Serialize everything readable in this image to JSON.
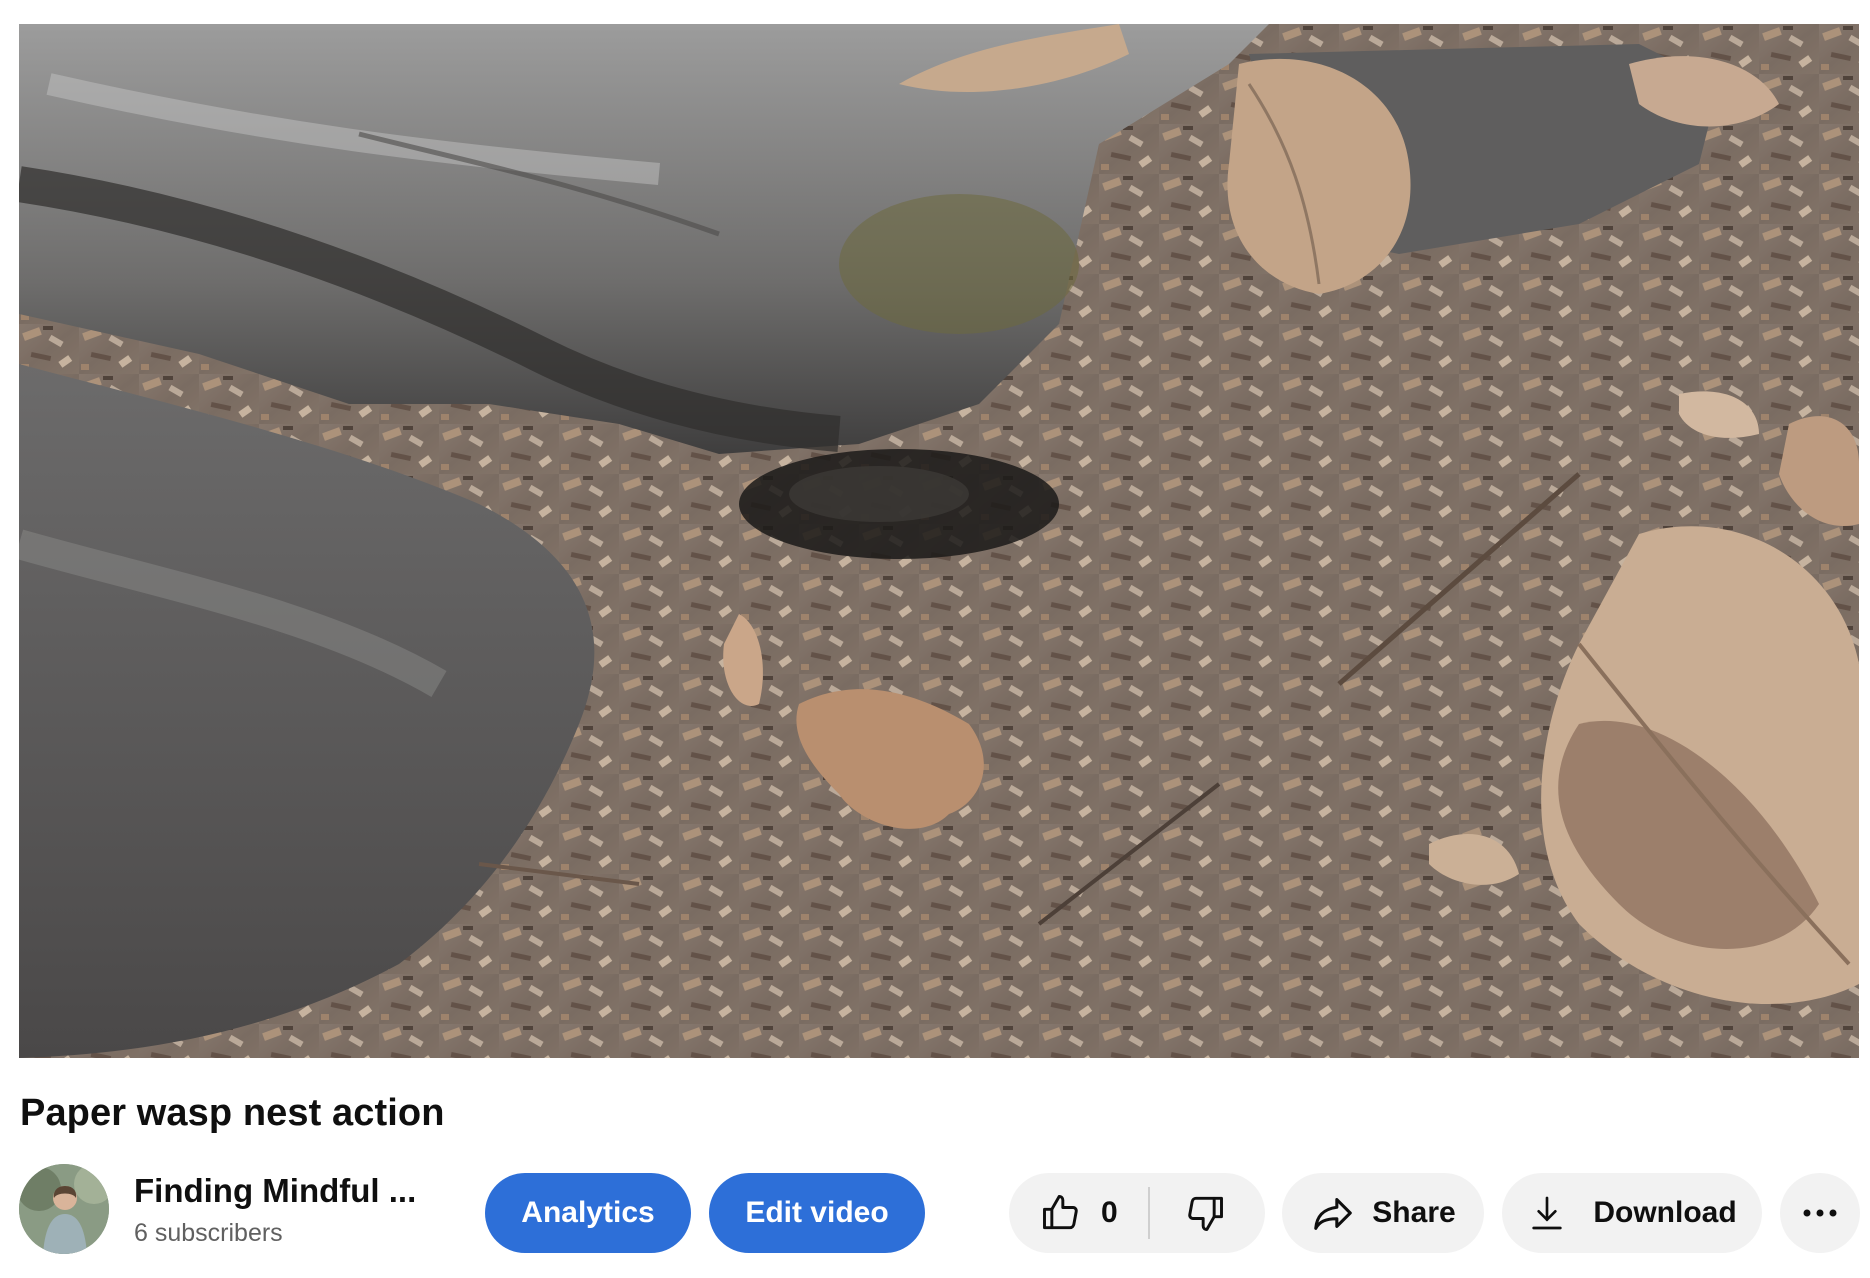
{
  "video": {
    "title": "Paper wasp nest action",
    "scene": "wasp-nest-video-frame"
  },
  "channel": {
    "name": "Finding Mindful ...",
    "subscribers": "6 subscribers",
    "avatar": "channel-avatar-person"
  },
  "actions": {
    "analytics_label": "Analytics",
    "edit_label": "Edit video",
    "like_count": "0",
    "like_icon": "thumbs-up-icon",
    "dislike_icon": "thumbs-down-icon",
    "share_label": "Share",
    "share_icon": "share-arrow-icon",
    "download_label": "Download",
    "download_icon": "download-icon",
    "more_icon": "more-horizontal-icon"
  },
  "colors": {
    "primary_button": "#2d6fd8",
    "secondary_button": "#f2f2f2",
    "text_primary": "#0f0f0f",
    "text_secondary": "#606060"
  }
}
